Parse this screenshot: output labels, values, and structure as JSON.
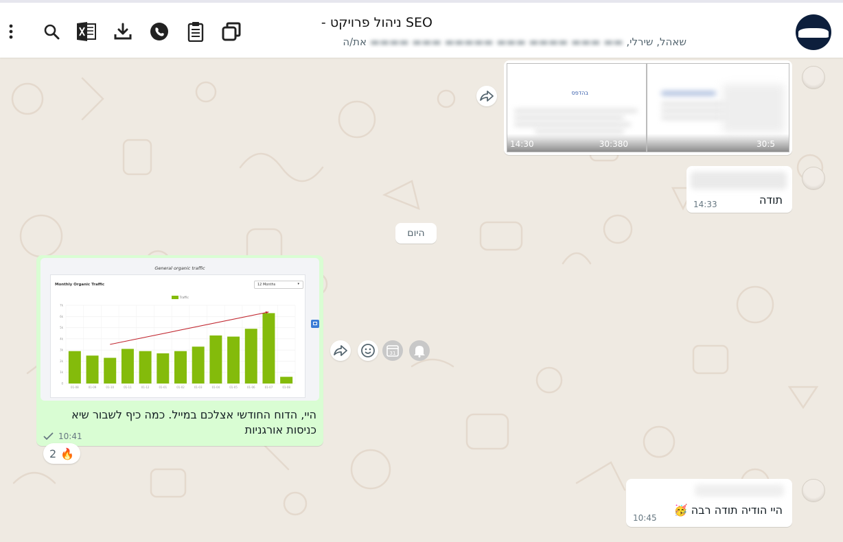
{
  "header": {
    "title": "SEO ניהול פרויקט -",
    "subtitle_visible": "שאהל, שירלי,",
    "subtitle_tail": "את/ה",
    "icons": [
      "menu-dots-icon",
      "search-icon",
      "excel-icon",
      "download-icon",
      "whatsapp-icon",
      "clipboard-icon",
      "copy-icon"
    ]
  },
  "messages": {
    "doc": {
      "time_left": "14:30",
      "time_mid": "30:380",
      "time_right": "30:5",
      "text_link": "בהדפס"
    },
    "thanks": {
      "text": "תודה",
      "time": "14:33"
    },
    "date_divider": "היום",
    "report": {
      "text": "היי, הדוח החודשי אצלכם במייל. כמה כיף לשבור שיא כניסות אורגניות",
      "time": "10:41",
      "reaction_count": "2",
      "reaction_emoji": "🔥"
    },
    "last": {
      "text": "היי הודיה תודה רבה",
      "emoji": "🥳",
      "time": "10:45"
    }
  },
  "report_chart": {
    "caption": "General organic traffic",
    "panel_title": "Monthly Organic Traffic",
    "dropdown": "12 Months",
    "legend": "Traffic"
  },
  "chart_data": {
    "type": "bar",
    "categories": [
      "01-08",
      "01-09",
      "01-10",
      "01-11",
      "01-12",
      "01-01",
      "01-02",
      "01-03",
      "01-04",
      "01-05",
      "01-06",
      "01-07",
      "01-08"
    ],
    "values": [
      2.9,
      2.5,
      2.3,
      3.1,
      2.9,
      2.7,
      2.9,
      3.3,
      4.3,
      4.2,
      4.9,
      6.3,
      0.6
    ],
    "ylim": [
      0,
      7
    ],
    "ytick_labels": [
      "0",
      "1k",
      "2k",
      "3k",
      "4k",
      "5k",
      "6k",
      "7k"
    ],
    "trend_line": {
      "from_index": 2,
      "to_index": 11
    },
    "bar_color": "#84bb0b",
    "trend_color": "#c0262f",
    "grid": true
  },
  "colors": {
    "outgoing_bubble": "#d9fdd3",
    "incoming_bubble": "#ffffff",
    "background": "#efeae2"
  }
}
